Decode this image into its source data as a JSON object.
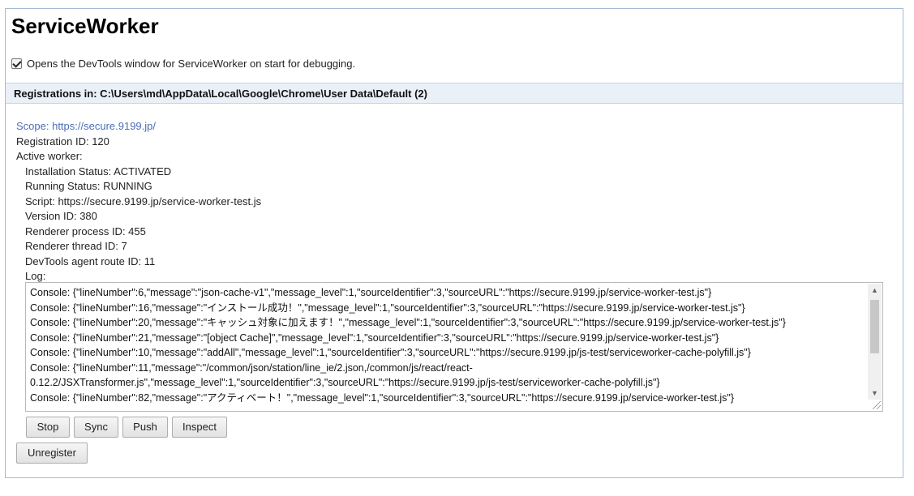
{
  "page": {
    "title": "ServiceWorker",
    "debug_option_label": "Opens the DevTools window for ServiceWorker on start for debugging.",
    "debug_option_checked": true
  },
  "registrations": {
    "header": "Registrations in: C:\\Users\\md\\AppData\\Local\\Google\\Chrome\\User Data\\Default (2)"
  },
  "registration": {
    "scope": "Scope: https://secure.9199.jp/",
    "registration_id": "Registration ID: 120",
    "active_worker_label": "Active worker:",
    "installation_status": "Installation Status: ACTIVATED",
    "running_status": "Running Status: RUNNING",
    "script": "Script: https://secure.9199.jp/service-worker-test.js",
    "version_id": "Version ID: 380",
    "renderer_process_id": "Renderer process ID: 455",
    "renderer_thread_id": "Renderer thread ID: 7",
    "devtools_route_id": "DevTools agent route ID: 11",
    "log_label": "Log:",
    "log_lines": [
      "Console: {\"lineNumber\":6,\"message\":\"json-cache-v1\",\"message_level\":1,\"sourceIdentifier\":3,\"sourceURL\":\"https://secure.9199.jp/service-worker-test.js\"}",
      "Console: {\"lineNumber\":16,\"message\":\"インストール成功！\",\"message_level\":1,\"sourceIdentifier\":3,\"sourceURL\":\"https://secure.9199.jp/service-worker-test.js\"}",
      "Console: {\"lineNumber\":20,\"message\":\"キャッシュ対象に加えます！\",\"message_level\":1,\"sourceIdentifier\":3,\"sourceURL\":\"https://secure.9199.jp/service-worker-test.js\"}",
      "Console: {\"lineNumber\":21,\"message\":\"[object Cache]\",\"message_level\":1,\"sourceIdentifier\":3,\"sourceURL\":\"https://secure.9199.jp/service-worker-test.js\"}",
      "Console: {\"lineNumber\":10,\"message\":\"addAll\",\"message_level\":1,\"sourceIdentifier\":3,\"sourceURL\":\"https://secure.9199.jp/js-test/serviceworker-cache-polyfill.js\"}",
      "Console: {\"lineNumber\":11,\"message\":\"/common/json/station/line_ie/2.json,/common/js/react/react-\n0.12.2/JSXTransformer.js\",\"message_level\":1,\"sourceIdentifier\":3,\"sourceURL\":\"https://secure.9199.jp/js-test/serviceworker-cache-polyfill.js\"}",
      "Console: {\"lineNumber\":82,\"message\":\"アクティベート！\",\"message_level\":1,\"sourceIdentifier\":3,\"sourceURL\":\"https://secure.9199.jp/service-worker-test.js\"}"
    ],
    "buttons": {
      "stop": "Stop",
      "sync": "Sync",
      "push": "Push",
      "inspect": "Inspect",
      "unregister": "Unregister"
    }
  }
}
